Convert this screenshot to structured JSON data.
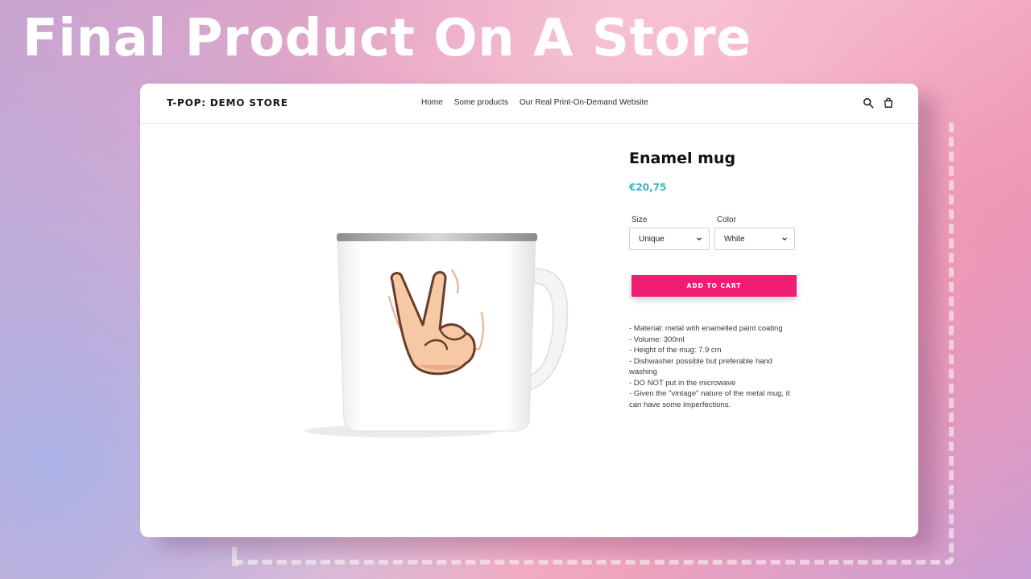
{
  "hero": {
    "title": "Final Product On A Store"
  },
  "store": {
    "logo": "T-POP: DEMO STORE",
    "nav": [
      "Home",
      "Some products",
      "Our Real Print-On-Demand Website"
    ],
    "icons": [
      "search-icon",
      "cart-icon"
    ]
  },
  "product": {
    "title": "Enamel mug",
    "price": "€20,75",
    "options": [
      {
        "label": "Size",
        "value": "Unique"
      },
      {
        "label": "Color",
        "value": "White"
      }
    ],
    "add_to_cart": "ADD TO CART",
    "description": [
      "- Material: metal with enamelled paint coating",
      "- Volume: 300ml",
      "- Height of the mug: 7.9 cm",
      "- Dishwasher possible but preferable hand",
      "washing",
      "- DO NOT put in the microwave",
      "- Given the \"vintage\" nature of the metal mug, it",
      "can have some imperfections."
    ]
  },
  "colors": {
    "accent": "#f01e72",
    "price": "#3cb6c2",
    "hero_text": "#ffffff"
  }
}
